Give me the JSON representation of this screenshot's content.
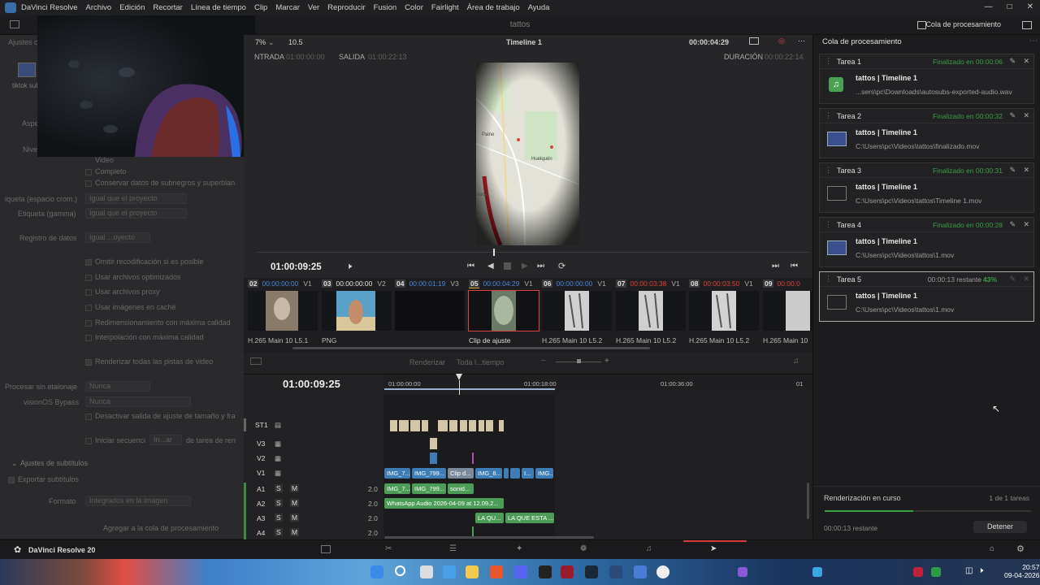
{
  "app": {
    "menu": [
      "DaVinci Resolve",
      "Archivo",
      "Edición",
      "Recortar",
      "Línea de tiempo",
      "Clip",
      "Marcar",
      "Ver",
      "Reproducir",
      "Fusion",
      "Color",
      "Fairlight",
      "Área de trabajo",
      "Ayuda"
    ],
    "project_title": "tattos",
    "queue_toggle_label": "Cola de procesamiento"
  },
  "left_panel": {
    "header": "Ajustes c",
    "preset_label": "tiktok sub",
    "labels": {
      "aspect": "Aspe",
      "level": "Nive",
      "video_opt": "Video",
      "complete": "Completo",
      "keep_data": "Conservar datos de subnegros y superblan",
      "color_space_tag": "iqueta (espacio crom.)",
      "gamma_tag": "Etiqueta (gamma)",
      "data_levels": "Registro de datos",
      "color_space_val": "Igual que el proyecto",
      "gamma_val": "Igual que el proyecto",
      "data_levels_val": "Igual ...oyecto",
      "bypass_reencode": "Omitir recodificación si es posible",
      "use_optimized": "Usar archivos optimizados",
      "use_proxy": "Usar archivos proxy",
      "use_cache": "Usar imágenes en caché",
      "max_resize": "Redimensionamiento con máxima calidad",
      "max_interp": "Interpolación con máxima calidad",
      "render_all": "Renderizar todas las pistas de video",
      "process_without": "Procesar sin etalonaje",
      "process_without_val": "Nunca",
      "visionos": "visionOS Bypass",
      "visionos_val": "Nunca",
      "disable_output": "Desactivar salida de ajuste de tamaño y fra",
      "start_seq": "Iniciar secuenci",
      "start_seq_val": "In...ar",
      "start_seq_tail": "de tarea de ren",
      "subtitles_section": "Ajustes de subtítulos",
      "export_subtitles": "Exportar subtítulos",
      "format": "Formato",
      "format_val": "Integrados en la imagen",
      "add_queue": "Agregar a la cola de procesamiento"
    }
  },
  "viewer": {
    "zoom": "7%",
    "fps": "10.5",
    "timeline_name": "Timeline 1",
    "timecode_top": "00:00:04:29",
    "in_label": "NTRADA",
    "in_tc": "01:00:00:00",
    "out_label": "SALIDA",
    "out_tc": "01:00:22:13",
    "duration_label": "DURACIÓN",
    "duration_tc": "00:00:22:14",
    "map_label_1": "Paine",
    "map_label_2": "Huelquén",
    "map_label_3": "ostal",
    "current_tc": "01:00:09:25"
  },
  "clips": [
    {
      "num": "02",
      "tc": "00:00:00:00",
      "track": "V1",
      "codec": "H.265 Main 10 L5.1",
      "tc_color": "#4a86d8"
    },
    {
      "num": "03",
      "tc": "00:00:00:00",
      "track": "V2",
      "codec": "PNG",
      "tc_color": "#e6e6e6"
    },
    {
      "num": "04",
      "tc": "00:00:01:19",
      "track": "V3",
      "codec": "",
      "tc_color": "#4a86d8"
    },
    {
      "num": "05",
      "tc": "00:00:04:29",
      "track": "V1",
      "codec": "Clip de ajuste",
      "tc_color": "#4a86d8"
    },
    {
      "num": "06",
      "tc": "00:00:00:00",
      "track": "V1",
      "codec": "H.265 Main 10 L5.2",
      "tc_color": "#4a86d8"
    },
    {
      "num": "07",
      "tc": "00:00:03:38",
      "track": "V1",
      "codec": "H.265 Main 10 L5.2",
      "tc_color": "#d9433b"
    },
    {
      "num": "08",
      "tc": "00:00:03:50",
      "track": "V1",
      "codec": "H.265 Main 10 L5.2",
      "tc_color": "#d9433b"
    },
    {
      "num": "09",
      "tc": "00:00:0",
      "track": "",
      "codec": "H.265 Main 10",
      "tc_color": "#d9433b"
    }
  ],
  "timeline": {
    "render_label": "Renderizar",
    "render_scope": "Toda l...tiempo",
    "current_tc": "01:00:09:25",
    "ruler": [
      "01:00:00:00",
      "01:00:18:00",
      "01:00:36:00",
      "01"
    ],
    "tracks": [
      {
        "name": "ST1",
        "vol": ""
      },
      {
        "name": "V3",
        "vol": ""
      },
      {
        "name": "V2",
        "vol": ""
      },
      {
        "name": "V1",
        "vol": ""
      },
      {
        "name": "A1",
        "vol": "2.0"
      },
      {
        "name": "A2",
        "vol": "2.0"
      },
      {
        "name": "A3",
        "vol": "2.0"
      },
      {
        "name": "A4",
        "vol": "2.0"
      }
    ],
    "v1_clips": [
      "IMG_7...",
      "IMG_799...",
      "Clip d...",
      "IMG_8...",
      "I...",
      "IMG..."
    ],
    "a1_clips": [
      "IMG_7...",
      "IMG_799...",
      "sonid..."
    ],
    "a2_clip": "WhatsApp Audio 2026-04-09 at 12.09.2...",
    "a3_clips": [
      "LA QU...",
      "LA QUE ESTA ..."
    ],
    "mute_labels": [
      "S",
      "M"
    ]
  },
  "queue": {
    "title": "Cola de procesamiento",
    "jobs": [
      {
        "task": "Tarea 1",
        "status": "Finalizado en 00:00:06",
        "name": "tattos | Timeline 1",
        "path": "...sers\\pc\\Downloads\\autosubs-exported-audio.wav",
        "icon": "audio"
      },
      {
        "task": "Tarea 2",
        "status": "Finalizado en 00:00:32",
        "name": "tattos | Timeline 1",
        "path": "C:\\Users\\pc\\Videos\\tattos\\finalizado.mov",
        "icon": "monitor"
      },
      {
        "task": "Tarea 3",
        "status": "Finalizado en 00:00:31",
        "name": "tattos | Timeline 1",
        "path": "C:\\Users\\pc\\Videos\\tattos\\Timeline 1.mov",
        "icon": "film"
      },
      {
        "task": "Tarea 4",
        "status": "Finalizado en 00:00:28",
        "name": "tattos | Timeline 1",
        "path": "C:\\Users\\pc\\Videos\\tattos\\1.mov",
        "icon": "monitor"
      },
      {
        "task": "Tarea 5",
        "status": "00:00:13 restante",
        "percent": "43%",
        "progress": 0.43,
        "name": "tattos | Timeline 1",
        "path": "C:\\Users\\pc\\Videos\\tattos\\1.mov",
        "icon": "film"
      }
    ],
    "rendering_label": "Renderización en curso",
    "rendering_count": "1 de 1 tareas",
    "remaining": "00:00:13 restante",
    "stop_button": "Detener"
  },
  "pagebar": {
    "brand": "DaVinci Resolve 20"
  },
  "taskbar": {
    "time": "20:57",
    "date": "09-04-2026"
  },
  "colors": {
    "accent_green": "#3b9d44",
    "timecode_blue": "#4a86d8",
    "timecode_red": "#d9433b",
    "v1_clip": "#3d7cb4",
    "a1_clip": "#4c9c57"
  }
}
